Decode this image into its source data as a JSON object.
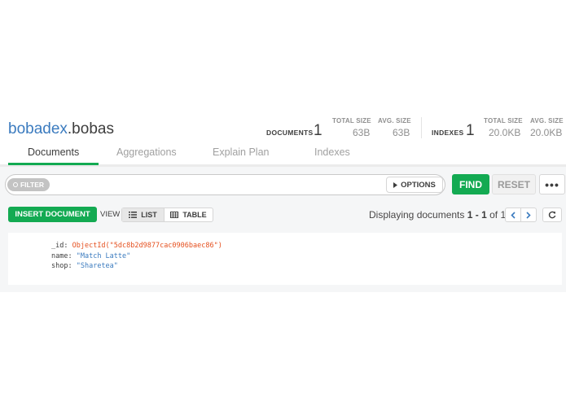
{
  "namespace": {
    "database": "bobadex",
    "collection": ".bobas"
  },
  "stats": {
    "documents": {
      "label": "DOCUMENTS",
      "count": "1",
      "total_size_label": "TOTAL SIZE",
      "total_size": "63B",
      "avg_size_label": "AVG. SIZE",
      "avg_size": "63B"
    },
    "indexes": {
      "label": "INDEXES",
      "count": "1",
      "total_size_label": "TOTAL SIZE",
      "total_size": "20.0KB",
      "avg_size_label": "AVG. SIZE",
      "avg_size": "20.0KB"
    }
  },
  "tabs": [
    {
      "label": "Documents",
      "active": true
    },
    {
      "label": "Aggregations",
      "active": false
    },
    {
      "label": "Explain Plan",
      "active": false
    },
    {
      "label": "Indexes",
      "active": false
    }
  ],
  "querybar": {
    "filter_label": "FILTER",
    "options_label": "OPTIONS",
    "find_label": "FIND",
    "reset_label": "RESET",
    "more_label": "•••"
  },
  "toolbar": {
    "insert_label": "INSERT DOCUMENT",
    "view_label": "VIEW",
    "list_label": "LIST",
    "table_label": "TABLE",
    "display_prefix": "Displaying documents ",
    "display_range": "1 - 1",
    "display_of": " of ",
    "display_total": "1"
  },
  "document": {
    "fields": [
      {
        "key": "_id",
        "value": "ObjectId(\"5dc8b2d9877cac0906baec86\")",
        "type": "objectid"
      },
      {
        "key": "name",
        "value": "\"Match Latte\"",
        "type": "string"
      },
      {
        "key": "shop",
        "value": "\"Sharetea\"",
        "type": "string"
      }
    ]
  },
  "colors": {
    "brand_green": "#13aa52",
    "link_blue": "#3b7bbf",
    "objectid_orange": "#e5501f"
  },
  "icons": {
    "filter": "filter-dot-icon",
    "options": "caret-right-icon",
    "list": "list-icon",
    "table": "table-grid-icon",
    "prev": "chevron-left-icon",
    "next": "chevron-right-icon",
    "refresh": "refresh-icon"
  }
}
